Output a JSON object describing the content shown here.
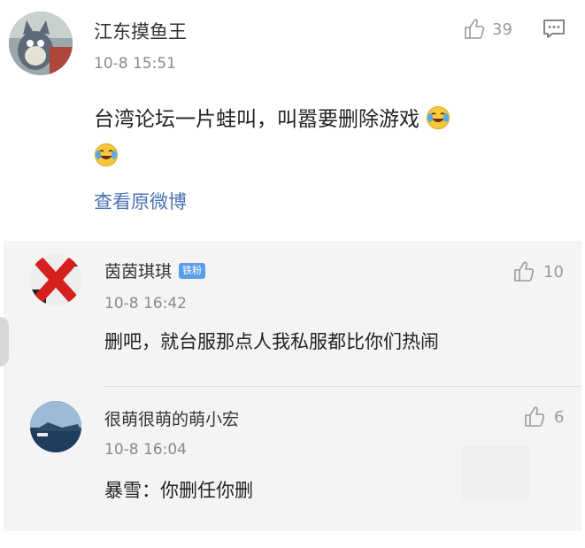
{
  "main_comment": {
    "user_name": "江东摸鱼王",
    "time": "10-8 15:51",
    "likes": "39",
    "text": "台湾论坛一片蛙叫，叫嚣要删除游戏",
    "link_text": "查看原微博"
  },
  "replies": [
    {
      "user_name": "茵茵琪琪",
      "badge": "铁粉",
      "time": "10-8 16:42",
      "likes": "10",
      "text": "删吧，就台服那点人我私服都比你们热闹"
    },
    {
      "user_name": "很萌很萌的萌小宏",
      "time": "10-8 16:04",
      "likes": "6",
      "text": "暴雪：你删任你删"
    }
  ],
  "icons": {
    "like": "thumbs-up-icon",
    "reply": "comment-icon",
    "emoji": "laughing-crying-emoji"
  },
  "colors": {
    "link": "#4a73b0",
    "badge": "#5b9de8",
    "reply_background": "#f4f4f4"
  }
}
